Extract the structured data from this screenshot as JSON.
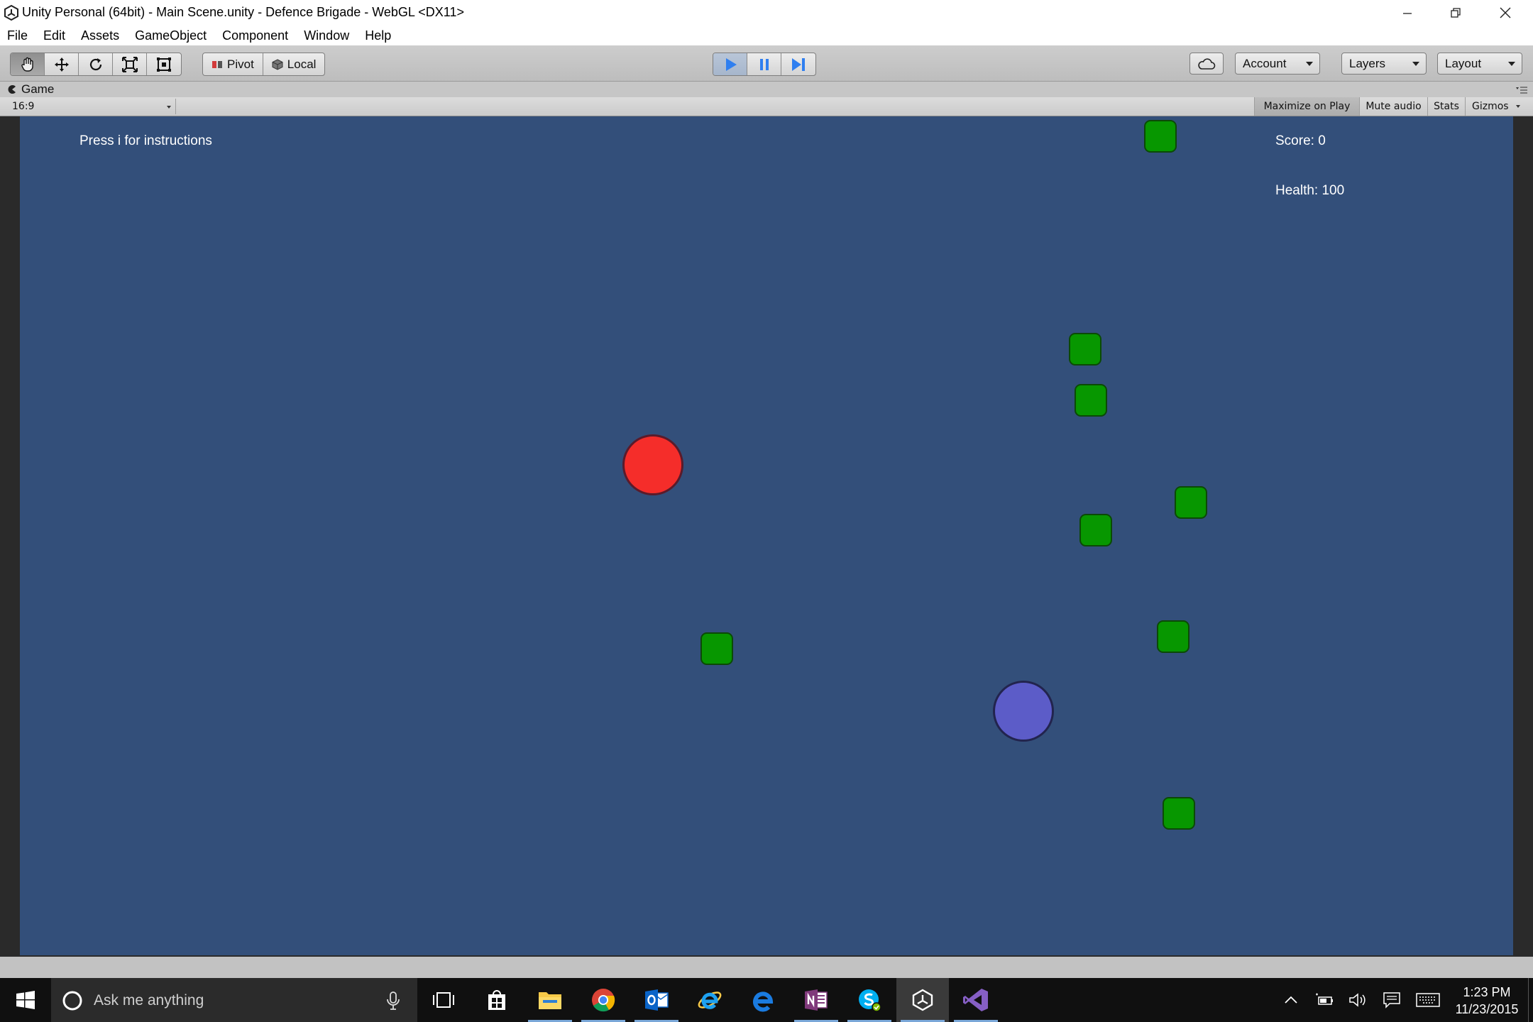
{
  "window": {
    "title": "Unity Personal (64bit) - Main Scene.unity - Defence Brigade - WebGL <DX11>"
  },
  "menu": [
    "File",
    "Edit",
    "Assets",
    "GameObject",
    "Component",
    "Window",
    "Help"
  ],
  "toolbar": {
    "tools": [
      "hand-icon",
      "move-icon",
      "rotate-icon",
      "scale-icon",
      "rect-tool-icon"
    ],
    "pivot_label": "Pivot",
    "local_label": "Local",
    "account_label": "Account",
    "layers_label": "Layers",
    "layout_label": "Layout"
  },
  "game_panel": {
    "tab_label": "Game",
    "aspect": "16:9",
    "maximize_label": "Maximize on Play",
    "mute_label": "Mute audio",
    "stats_label": "Stats",
    "gizmos_label": "Gizmos"
  },
  "game": {
    "instructions": "Press i for instructions",
    "score_text": "Score: 0",
    "health_text": "Health: 100"
  },
  "taskbar": {
    "search_placeholder": "Ask me anything",
    "time": "1:23 PM",
    "date": "11/23/2015"
  },
  "colors": {
    "scene_bg": "#334f7a",
    "enemy": "#079700",
    "player_red": "#f52d2a",
    "player_blue": "#5c5cc8",
    "play_accent": "#2f7ff0"
  }
}
